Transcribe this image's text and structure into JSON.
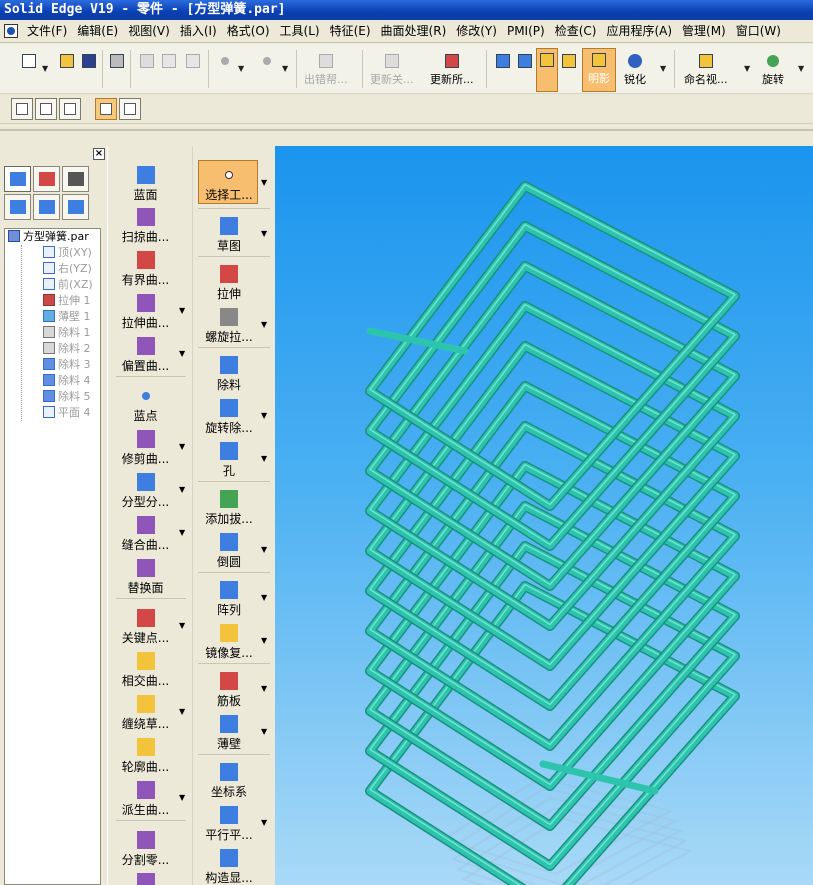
{
  "window": {
    "title": "Solid Edge V19 - 零件 - [方型弹簧.par]"
  },
  "menu": {
    "items": [
      "文件(F)",
      "编辑(E)",
      "视图(V)",
      "插入(I)",
      "格式(O)",
      "工具(L)",
      "特征(E)",
      "曲面处理(R)",
      "修改(Y)",
      "PMI(P)",
      "检查(C)",
      "应用程序(A)",
      "管理(M)",
      "窗口(W)"
    ]
  },
  "toolbar": {
    "error_label": "出错帮...",
    "update_related_label": "更新关...",
    "update_all_label": "更新所...",
    "shading_label": "明影",
    "sharpen_label": "锐化",
    "named_view_label": "命名视...",
    "rotate_label": "旋转"
  },
  "pathfinder": {
    "tree": [
      "方型弹簧.par",
      "顶(XY)",
      "右(YZ)",
      "前(XZ)",
      "拉伸 1",
      "薄壁 1",
      "除料 1",
      "除料 2",
      "除料 3",
      "除料 4",
      "除料 5",
      "平面 4"
    ]
  },
  "features_bar": {
    "col1": [
      "蓝面",
      "扫掠曲...",
      "有界曲...",
      "拉伸曲...",
      "偏置曲...",
      "蓝点",
      "修剪曲...",
      "分型分...",
      "缝合曲...",
      "替换面",
      "关键点...",
      "相交曲...",
      "缠绕草...",
      "轮廓曲...",
      "派生曲...",
      "分割零..."
    ],
    "col2": [
      "选择工...",
      "草图",
      "拉伸",
      "螺旋拉...",
      "除料",
      "旋转除...",
      "孔",
      "添加拔...",
      "倒圆",
      "阵列",
      "镜像复...",
      "筋板",
      "薄壁",
      "坐标系",
      "平行平...",
      "构造显..."
    ]
  },
  "colors": {
    "spring": "#2cc4ad",
    "spring_dark": "#1b8f80",
    "viewport_top": "#1a94ee",
    "viewport_bottom": "#a9d9f7",
    "highlight": "#f8be6f"
  }
}
